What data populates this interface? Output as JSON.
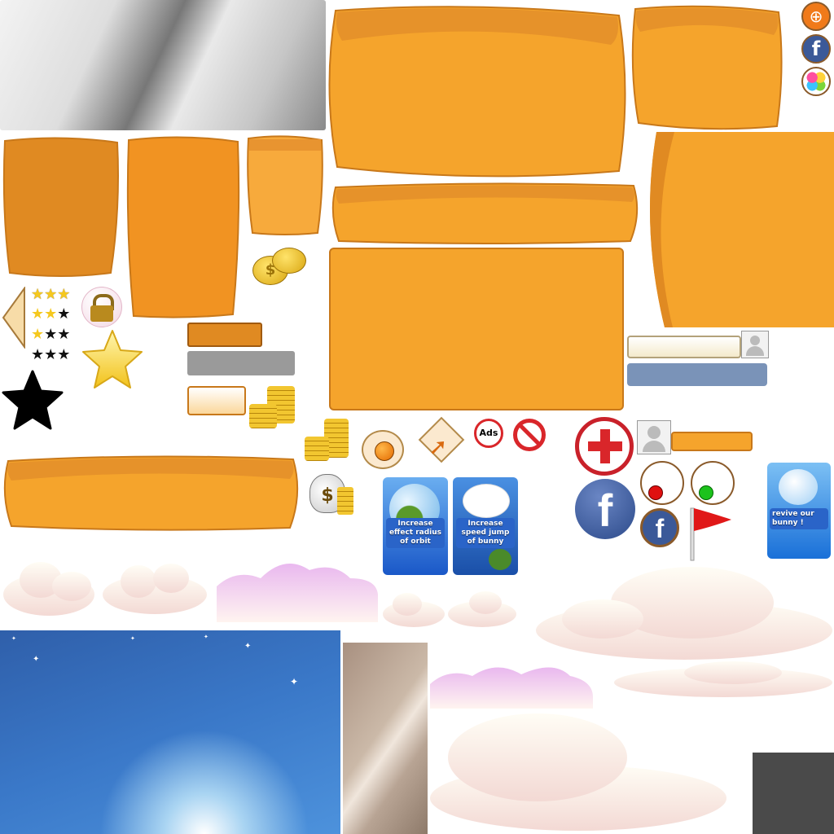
{
  "colors": {
    "orange": "#f5a42c",
    "orange_dark": "#e08a22",
    "orange_border": "#c8781a",
    "sky_top": "#3a78c8",
    "sky_bottom": "#a9d4f2",
    "facebook_blue": "#3b5998",
    "red_cross": "#d9262a",
    "cloud": "#f7ece0"
  },
  "powerups": [
    {
      "label": "Increase effect radius of orbit",
      "icon": "planet-bubble-icon"
    },
    {
      "label": "Increase speed jump of bunny",
      "icon": "winged-bunny-icon"
    },
    {
      "label": "revive our bunny !",
      "icon": "angel-bunny-icon"
    }
  ],
  "badges": {
    "no_ads": "Ads",
    "money": "$"
  },
  "icons": [
    "globe-icon",
    "facebook-icon",
    "game-center-icon",
    "lock-icon",
    "star-icon",
    "coin-stack-icon",
    "money-bag-icon",
    "no-ads-icon",
    "prohibited-icon",
    "share-icon",
    "health-plus-icon",
    "avatar-icon",
    "red-flag-icon",
    "back-arrow-icon"
  ]
}
